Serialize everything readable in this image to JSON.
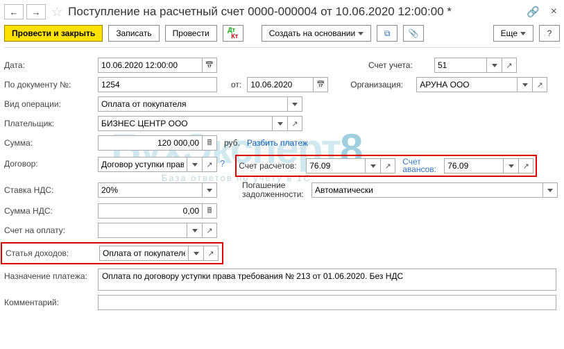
{
  "header": {
    "title": "Поступление на расчетный счет 0000-000004 от 10.06.2020 12:00:00 *"
  },
  "toolbar": {
    "post_and_close": "Провести и закрыть",
    "write": "Записать",
    "post": "Провести",
    "create_based": "Создать на основании",
    "more": "Еще"
  },
  "labels": {
    "date": "Дата:",
    "doc_no": "По документу №:",
    "from": "от:",
    "op_type": "Вид операции:",
    "payer": "Плательщик:",
    "amount": "Сумма:",
    "contract": "Договор:",
    "vat_rate": "Ставка НДС:",
    "vat_amount": "Сумма НДС:",
    "invoice": "Счет на оплату:",
    "income_item": "Статья доходов:",
    "purpose": "Назначение платежа:",
    "comment": "Комментарий:",
    "account": "Счет учета:",
    "organization": "Организация:",
    "split": "Разбить платеж",
    "settle_acc": "Счет расчетов:",
    "advance_acc": "Счет авансов:",
    "debt_repay1": "Погашение",
    "debt_repay2": "задолженности:",
    "rub": "руб."
  },
  "values": {
    "date": "10.06.2020 12:00:00",
    "doc_no": "1254",
    "doc_date": "10.06.2020",
    "account": "51",
    "organization": "АРУНА ООО",
    "op_type": "Оплата от покупателя",
    "payer": "БИЗНЕС ЦЕНТР ООО",
    "amount": "120 000,00",
    "contract": "Договор уступки права тр",
    "settle_acc": "76.09",
    "advance_acc": "76.09",
    "debt_repay": "Автоматически",
    "vat_rate": "20%",
    "vat_amount": "0,00",
    "income_item": "Оплата от покупателей",
    "purpose": "Оплата по договору уступки права требования № 213 от 01.06.2020. Без НДС"
  }
}
